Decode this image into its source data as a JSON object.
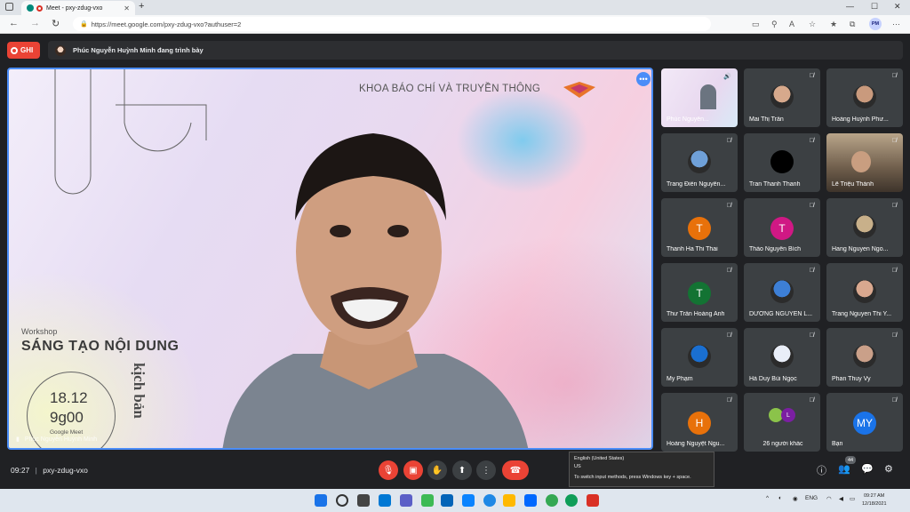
{
  "browser": {
    "tab_title": "Meet - pxy-zdug-vxo",
    "url": "https://meet.google.com/pxy-zdug-vxo?authuser=2",
    "profile_initials": "PM"
  },
  "meet": {
    "record_label": "GHI",
    "presenting_text": "Phúc Nguyễn Huỳnh Minh đang trình bày",
    "time": "09:27",
    "code": "pxy-zdug-vxo",
    "participants_badge": "44"
  },
  "slide": {
    "org": "KHOA BÁO CHÍ VÀ TRUYỀN THÔNG",
    "workshop": "Workshop",
    "title": "SÁNG TẠO NỘI DUNG",
    "vertical": "kịch bản",
    "date": "18.12",
    "time": "9g00",
    "platform": "Google Meet",
    "presenter_caption": "Phúc Nguyễn Huỳnh Minh"
  },
  "tiles": [
    {
      "name": "Phúc Nguyễn...",
      "kind": "screen",
      "color": "#ffffff"
    },
    {
      "name": "Mai Thị Trần",
      "kind": "photo",
      "color": "#d7a98c"
    },
    {
      "name": "Hoàng Huỳnh Phư...",
      "kind": "photo",
      "color": "#c99a7d"
    },
    {
      "name": "Trang Điền Nguyễn...",
      "kind": "photo",
      "color": "#6fa0d8"
    },
    {
      "name": "Tran Thanh Thanh",
      "kind": "photo",
      "color": "#000000"
    },
    {
      "name": "Lê Triệu Thành",
      "kind": "camera",
      "color": "#8a7a66"
    },
    {
      "name": "Thanh Ha Thi Thai",
      "kind": "letter",
      "letter": "T",
      "color": "#e8710a"
    },
    {
      "name": "Thảo Nguyễn Bích",
      "kind": "letter",
      "letter": "T",
      "color": "#d01884"
    },
    {
      "name": "Hang Nguyen Ngo...",
      "kind": "photo",
      "color": "#c8b08a"
    },
    {
      "name": "Thư Trần Hoàng Anh",
      "kind": "letter",
      "letter": "T",
      "color": "#137333"
    },
    {
      "name": "DƯƠNG NGUYỄN L...",
      "kind": "photo",
      "color": "#3d7fd6"
    },
    {
      "name": "Trang Nguyen Thi Y...",
      "kind": "photo",
      "color": "#d9a88f"
    },
    {
      "name": "My Phạm",
      "kind": "photo",
      "color": "#1a6fd1"
    },
    {
      "name": "Hà Duy Bùi Ngọc",
      "kind": "photo",
      "color": "#e9eef8"
    },
    {
      "name": "Phan Thuy Vy",
      "kind": "photo",
      "color": "#caa089"
    },
    {
      "name": "Hoàng Nguyệt Ngu...",
      "kind": "letter",
      "letter": "H",
      "color": "#e8710a"
    },
    {
      "name": "26 người khác",
      "kind": "others",
      "letter": "L",
      "color": "#7b1fa2"
    },
    {
      "name": "Bạn",
      "kind": "letter",
      "letter": "MY",
      "color": "#1a73e8"
    }
  ],
  "tooltip": {
    "line1": "English (United States)",
    "line2": "US",
    "line3": "To switch input methods, press Windows key + space."
  },
  "tray": {
    "lang": "ENG",
    "time": "09:27 AM",
    "date": "12/18/2021"
  }
}
